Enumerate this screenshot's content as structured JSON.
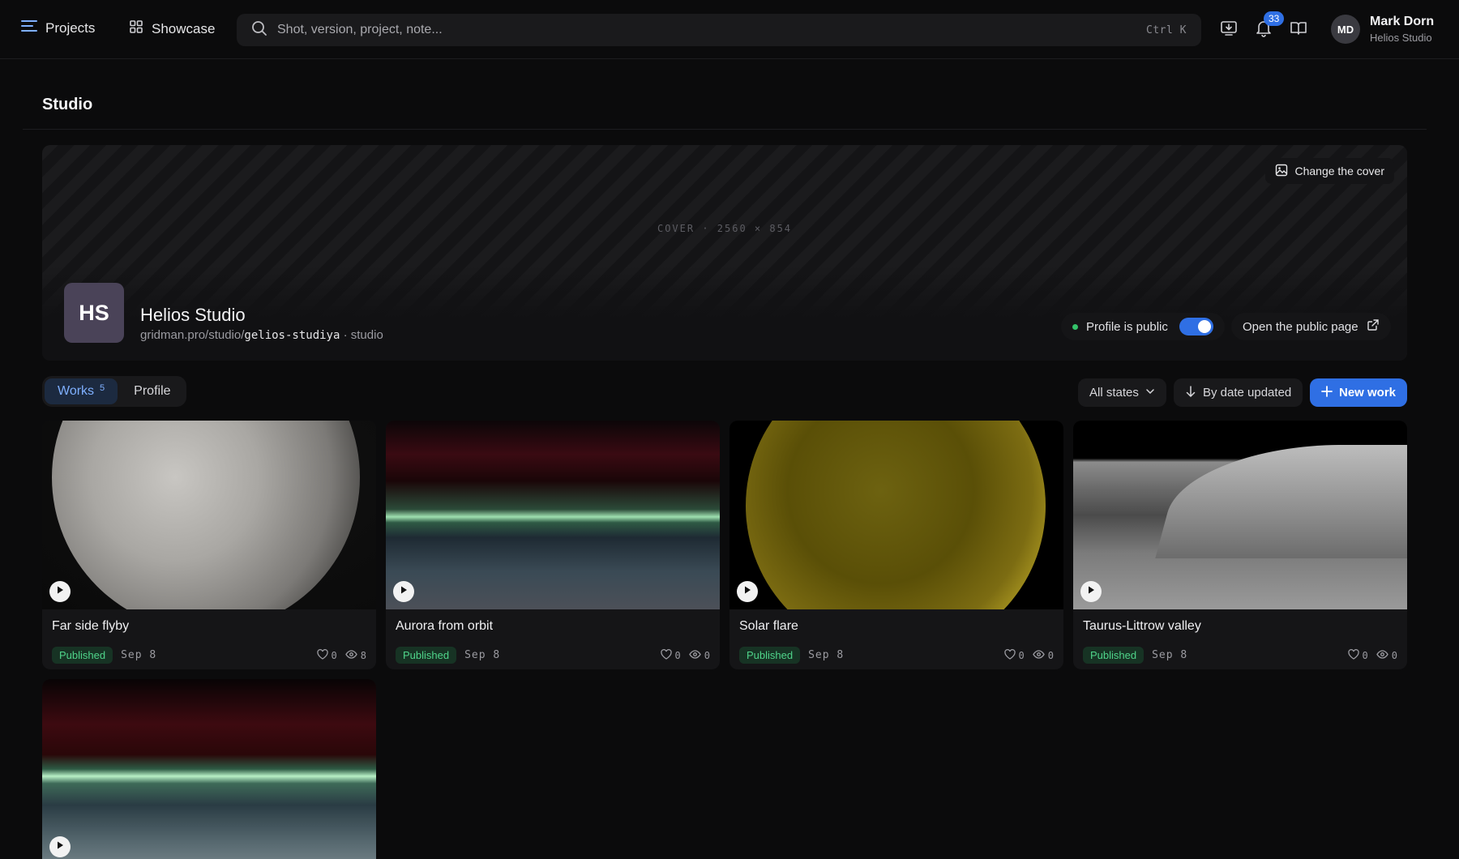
{
  "topbar": {
    "projects_label": "Projects",
    "showcase_label": "Showcase",
    "search_placeholder": "Shot, version, project, note...",
    "search_shortcut": "Ctrl K",
    "notifications_count": "33",
    "user": {
      "initials": "MD",
      "name": "Mark Dorn",
      "org": "Helios Studio"
    }
  },
  "page": {
    "title": "Studio"
  },
  "cover": {
    "label": "COVER · 2560 × 854",
    "change_label": "Change the cover"
  },
  "studio": {
    "initials": "HS",
    "name": "Helios Studio",
    "url_prefix": "gridman.pro/studio/",
    "slug": "gelios-studiya",
    "type_suffix": "· studio",
    "public_label": "Profile is public",
    "public_enabled": true,
    "open_public_label": "Open the public page"
  },
  "toolbar": {
    "tabs": [
      {
        "label": "Works",
        "count": "5",
        "active": true
      },
      {
        "label": "Profile",
        "active": false
      }
    ],
    "state_filter": "All states",
    "sort_label": "By date updated",
    "new_work_label": "New work"
  },
  "works": [
    {
      "title": "Far side flyby",
      "status": "Published",
      "date": "Sep 8",
      "likes": "0",
      "views": "8"
    },
    {
      "title": "Aurora from orbit",
      "status": "Published",
      "date": "Sep 8",
      "likes": "0",
      "views": "0"
    },
    {
      "title": "Solar flare",
      "status": "Published",
      "date": "Sep 8",
      "likes": "0",
      "views": "0"
    },
    {
      "title": "Taurus-Littrow valley",
      "status": "Published",
      "date": "Sep 8",
      "likes": "0",
      "views": "0"
    },
    {
      "title": "",
      "status": "",
      "date": "",
      "likes": "",
      "views": ""
    }
  ],
  "colors": {
    "accent": "#2f6fe4",
    "success": "#4fd48a",
    "background": "#0b0b0c"
  },
  "icons": [
    "menu-icon",
    "grid-icon",
    "search-icon",
    "monitor-download-icon",
    "bell-icon",
    "book-open-icon",
    "image-edit-icon",
    "external-link-icon",
    "chevron-down-icon",
    "arrow-down-icon",
    "plus-icon",
    "play-icon",
    "heart-icon",
    "eye-icon"
  ]
}
